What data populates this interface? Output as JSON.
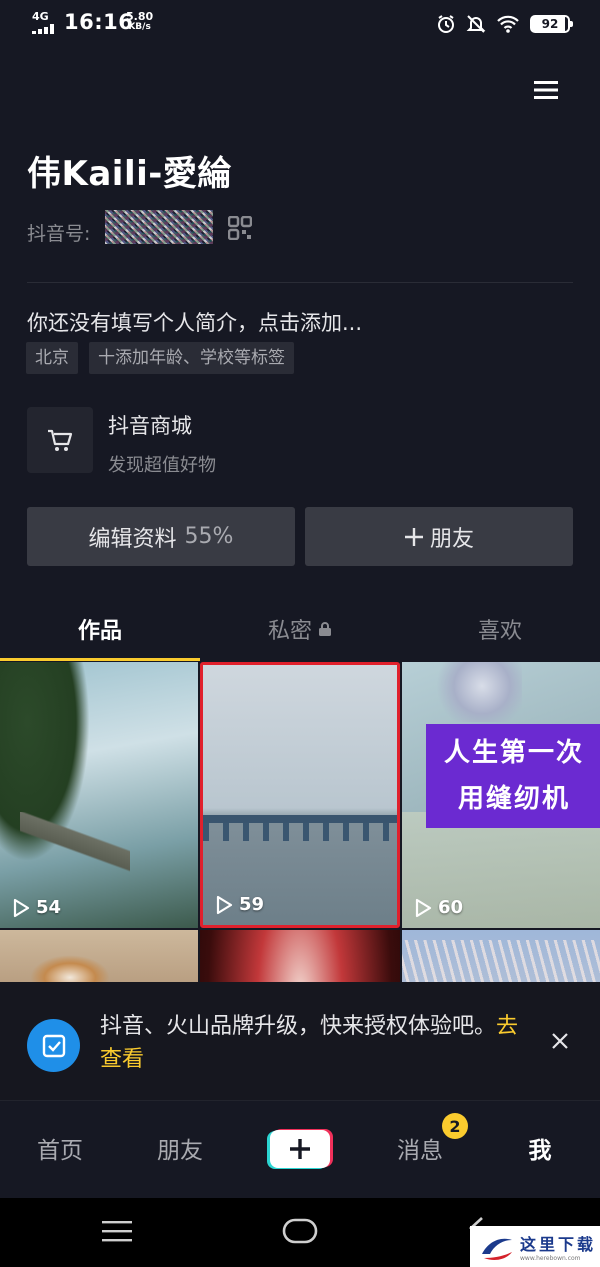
{
  "status_bar": {
    "network": "4G",
    "time": "16:16",
    "speed_value": "5.80",
    "speed_unit": "KB/s",
    "battery": "92",
    "icons": [
      "alarm-icon",
      "bell-off-icon",
      "wifi-icon",
      "battery-icon"
    ]
  },
  "profile": {
    "name": "伟Kaili-愛綸",
    "douyin_id_label": "抖音号:",
    "bio_placeholder": "你还没有填写个人简介，点击添加...",
    "tags": [
      "北京",
      "十添加年龄、学校等标签"
    ]
  },
  "shop": {
    "title": "抖音商城",
    "subtitle": "发现超值好物"
  },
  "actions": {
    "edit_label": "编辑资料",
    "edit_percent": "55%",
    "add_friend_label": "朋友"
  },
  "tabs": [
    {
      "label": "作品",
      "active": true
    },
    {
      "label": "私密",
      "active": false,
      "icon": "lock-icon"
    },
    {
      "label": "喜欢",
      "active": false
    }
  ],
  "videos": [
    {
      "views": "54"
    },
    {
      "views": "59",
      "selected": true
    },
    {
      "views": "60",
      "title_line1": "人生第一次",
      "title_line2": "用缝纫机"
    },
    {
      "views": ""
    },
    {
      "views": ""
    },
    {
      "views": ""
    }
  ],
  "banner": {
    "text": "抖音、火山品牌升级，快来授权体验吧。",
    "link": "去查看"
  },
  "bottom_nav": {
    "home": "首页",
    "friends": "朋友",
    "messages": "消息",
    "messages_badge": "2",
    "me": "我"
  },
  "watermark": {
    "text": "这里下载",
    "url": "www.herebown.com"
  },
  "colors": {
    "background": "#161823",
    "accent_yellow": "#facb2e",
    "selected_border": "#e0202c",
    "banner_icon": "#1f8fe8"
  }
}
